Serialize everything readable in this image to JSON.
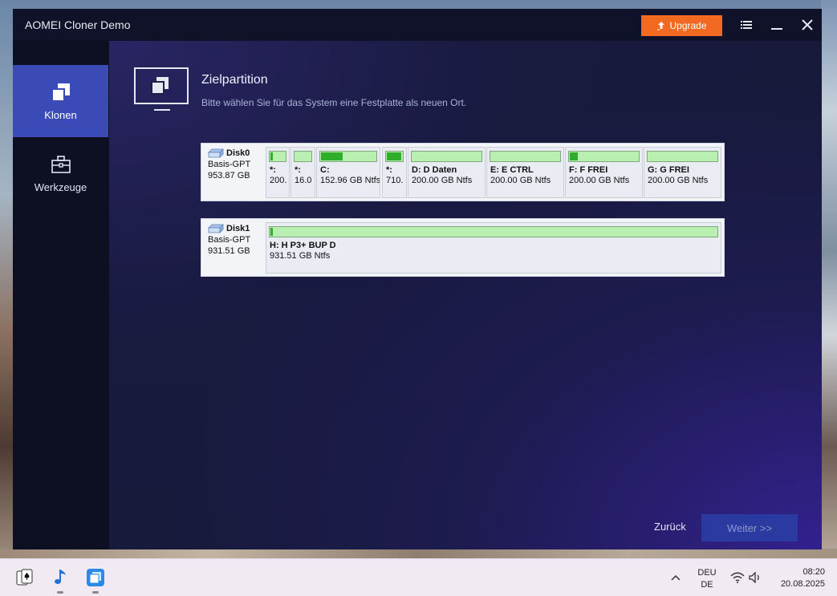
{
  "window": {
    "title": "AOMEI Cloner Demo",
    "upgrade_label": "Upgrade",
    "accent_color": "#f26a21"
  },
  "sidebar": {
    "items": [
      {
        "label": "Klonen",
        "icon": "clone-icon",
        "active": true
      },
      {
        "label": "Werkzeuge",
        "icon": "toolbox-icon",
        "active": false
      }
    ]
  },
  "header": {
    "title": "Zielpartition",
    "subtitle": "Bitte wählen Sie für das System eine Festplatte als neuen Ort."
  },
  "disks": [
    {
      "name": "Disk0",
      "type": "Basis-GPT",
      "size": "953.87 GB",
      "partitions": [
        {
          "name": "*:",
          "size": "200.",
          "used": 0.15
        },
        {
          "name": "*:",
          "size": "16.0",
          "used": 0.0
        },
        {
          "name": "C:",
          "size": "152.96 GB Ntfs",
          "used": 0.38
        },
        {
          "name": "*:",
          "size": "710.",
          "used": 0.85
        },
        {
          "name": "D: D Daten",
          "size": "200.00 GB Ntfs",
          "used": 0.0
        },
        {
          "name": "E: E CTRL",
          "size": "200.00 GB Ntfs",
          "used": 0.0
        },
        {
          "name": "F: F FREI",
          "size": "200.00 GB Ntfs",
          "used": 0.12
        },
        {
          "name": "G: G FREI",
          "size": "200.00 GB Ntfs",
          "used": 0.0
        }
      ]
    },
    {
      "name": "Disk1",
      "type": "Basis-GPT",
      "size": "931.51 GB",
      "partitions": [
        {
          "name": "H: H P3+ BUP D",
          "size": "931.51 GB Ntfs",
          "used": 0.01
        }
      ]
    }
  ],
  "footer": {
    "back_label": "Zurück",
    "next_label": "Weiter >>"
  },
  "taskbar": {
    "apps": [
      "solitaire-icon",
      "music-icon",
      "aomei-icon"
    ],
    "lang_line1": "DEU",
    "lang_line2": "DE",
    "time": "08:20",
    "date": "20.08.2025"
  }
}
